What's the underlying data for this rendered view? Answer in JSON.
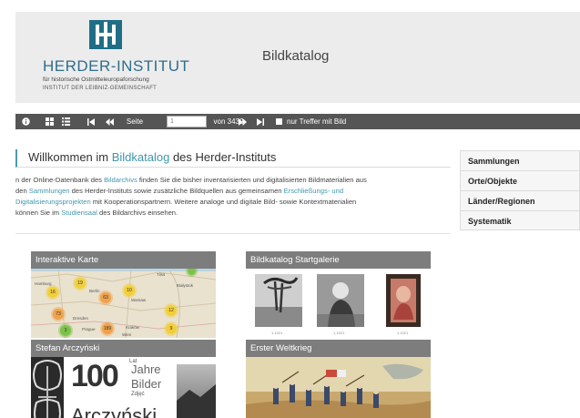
{
  "header": {
    "logo_name": "HERDER-INSTITUT",
    "logo_sub1": "für historische Ostmitteleuropaforschung",
    "logo_sub2": "INSTITUT DER LEIBNIZ-GEMEINSCHAFT",
    "app_title": "Bildkatalog"
  },
  "toolbar": {
    "page_label": "Seite",
    "page_value": "1",
    "page_total": "von 3439",
    "filter_label": "nur Treffer mit Bild"
  },
  "welcome": {
    "title_pre": "Willkommen im ",
    "title_link": "Bildkatalog",
    "title_post": " des Herder-Instituts"
  },
  "intro": {
    "l1_a": "n der Online-Datenbank des ",
    "l1_link": "Bildarchivs",
    "l1_b": " finden Sie die bisher inventarisierten und digitalisierten Bildmaterialien aus",
    "l2_a": "den ",
    "l2_link1": "Sammlungen",
    "l2_b": " des Herder-Instituts sowie zusätzliche Bildquellen aus gemeinsamen ",
    "l2_link2": "Erschließungs- und",
    "l3_link": "Digitalisierungsprojekten",
    "l3_b": " mit Kooperationspartnern. Weitere analoge und digitale Bild- sowie Kontextmaterialien",
    "l4_a": "können Sie im ",
    "l4_link": "Studiensaal",
    "l4_b": " des Bildarchivs einsehen."
  },
  "sidebar": {
    "items": [
      {
        "label": "Sammlungen"
      },
      {
        "label": "Orte/Objekte"
      },
      {
        "label": "Länder/Regionen"
      },
      {
        "label": "Systematik"
      }
    ]
  },
  "tiles": {
    "map": {
      "title": "Interaktive Karte",
      "clusters": [
        "16",
        "19",
        "63",
        "10",
        "73",
        "12",
        "3",
        "189",
        "9"
      ],
      "cities": [
        "Hamburg",
        "Berlin",
        "Warsaw",
        "Tilsit",
        "Białystok",
        "Dresden",
        "Prague",
        "Kraków",
        "Wien"
      ]
    },
    "gallery": {
      "title": "Bildkatalog Startgalerie",
      "captions": [
        "1.1921",
        "1.1921",
        "1.1921"
      ]
    },
    "arczynski": {
      "title": "Stefan Arczyński",
      "big_number": "100",
      "w1": "Jahre",
      "w2": "Bilder",
      "name": "Arczyński",
      "small1": "Lat",
      "small2": "Zdjęć"
    },
    "war": {
      "title": "Erster Weltkrieg"
    }
  },
  "colors": {
    "accent": "#3f97ad",
    "toolbar": "#555555",
    "tile_header": "#7d7d7d"
  }
}
